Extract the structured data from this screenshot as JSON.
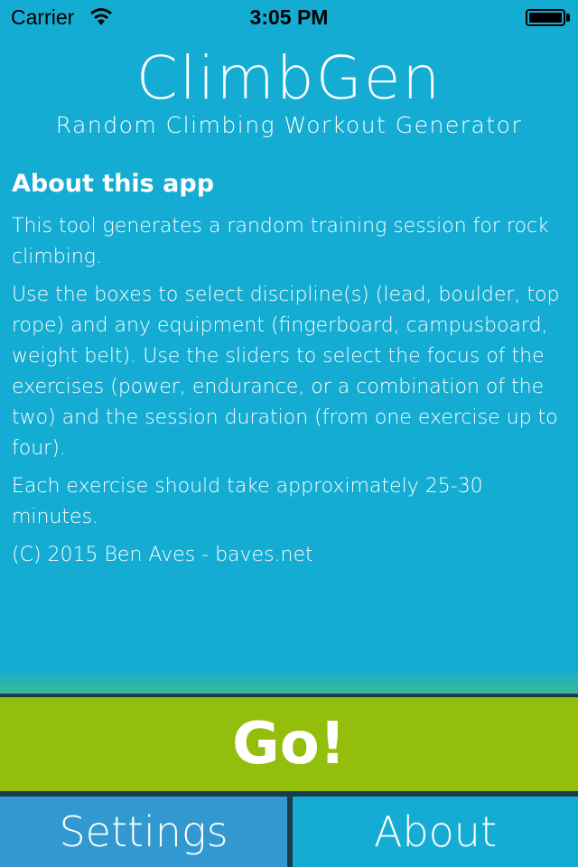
{
  "status_bar": {
    "carrier": "Carrier",
    "time": "3:05 PM",
    "wifi_icon": "wifi-icon",
    "battery_icon": "battery-icon"
  },
  "header": {
    "title": "ClimbGen",
    "subtitle": "Random Climbing Workout Generator"
  },
  "about": {
    "heading": "About this app",
    "paragraphs": [
      "This tool generates a random training session for rock climbing.",
      "Use the boxes to select discipline(s) (lead, boulder, top rope) and any equipment (fingerboard, campusboard, weight belt). Use the sliders to select the focus of the exercises (power, endurance, or a combination of the two) and the session duration (from one exercise up to four).",
      "Each exercise should take approximately 25-30 minutes.",
      "(C) 2015 Ben Aves - baves.net"
    ]
  },
  "actions": {
    "go_label": "Go!"
  },
  "tabs": [
    {
      "label": "Settings",
      "selected": true
    },
    {
      "label": "About",
      "selected": false
    }
  ],
  "colors": {
    "background": "#15acd3",
    "go": "#93bf0c",
    "settings_tab": "#3199cf",
    "divider": "#1b3d4a"
  }
}
